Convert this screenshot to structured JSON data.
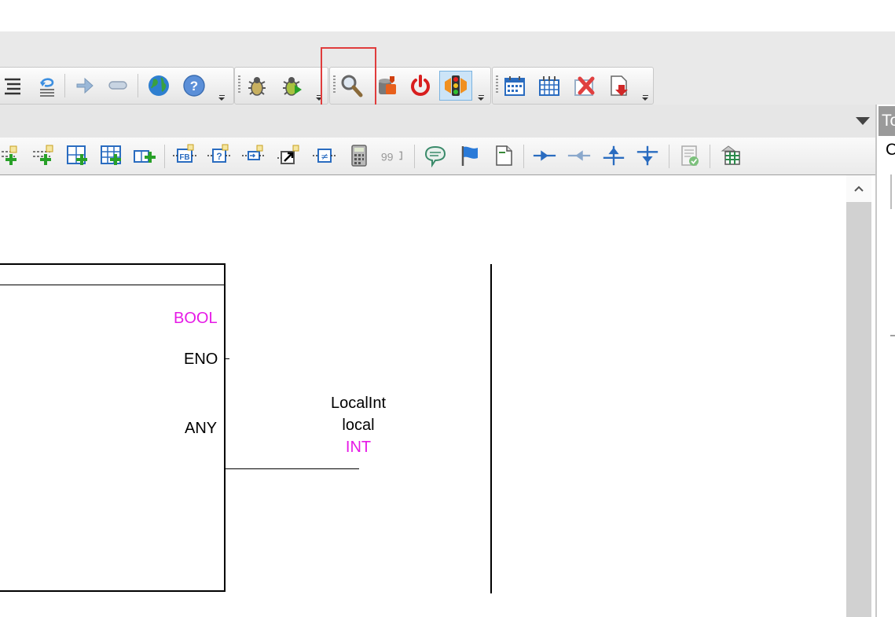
{
  "side_panel": {
    "tab_label": "To",
    "text": "C"
  },
  "diagram": {
    "block": {
      "output_type": "BOOL",
      "eno_label": "ENO",
      "output_label": "ANY"
    },
    "variable": {
      "name": "LocalInt",
      "scope": "local",
      "type": "INT"
    }
  },
  "colors": {
    "type_text": "#e619e6",
    "highlight_box": "#e03c3c",
    "toolbar_selected": "#cce4f7"
  },
  "icons": {
    "top_toolbar": [
      "list-icon",
      "undo-list-icon",
      "insert-arrow-icon",
      "link-icon",
      "globe-icon",
      "help-icon",
      "debug-settings-icon",
      "debug-run-icon",
      "search-icon",
      "database-icon",
      "power-icon",
      "traffic-light-icon",
      "calendar-icon",
      "grid-icon",
      "delete-icon",
      "export-icon"
    ],
    "lower_toolbar": [
      "add-contact-icon",
      "add-coil-icon",
      "add-grid-icon",
      "add-table-icon",
      "add-rung-icon",
      "fb-block-icon",
      "question-block-icon",
      "input-block-icon",
      "jump-icon",
      "compare-icon",
      "calculator-icon",
      "counter-icon",
      "comment-icon",
      "flag-icon",
      "page-icon",
      "connect-right-icon",
      "connect-left-icon",
      "connect-up-icon",
      "connect-down-icon",
      "verify-icon",
      "table-edit-icon"
    ]
  }
}
